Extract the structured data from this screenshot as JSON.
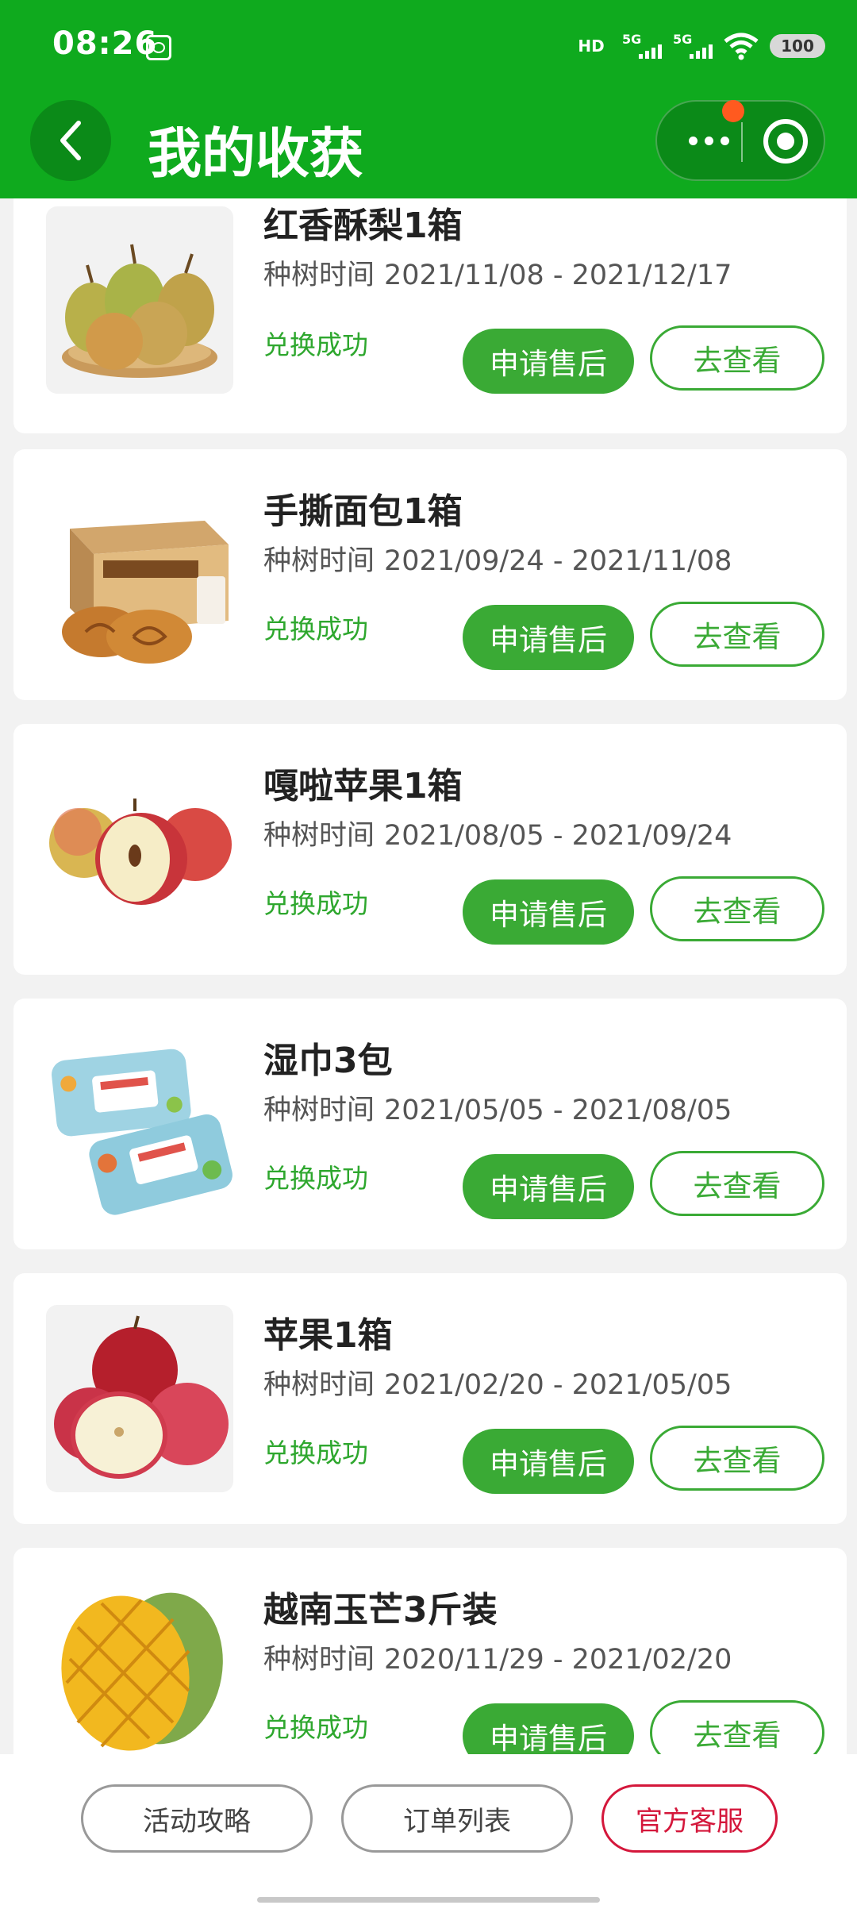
{
  "status_bar": {
    "time": "08:26",
    "hd_label": "HD",
    "net1": "5G",
    "net2": "5G",
    "battery": "100"
  },
  "header": {
    "title": "我的收获"
  },
  "items": [
    {
      "name": "红香酥梨1箱",
      "period_label": "种树时间",
      "period": "2021/11/08 - 2021/12/17",
      "status": "兑换成功",
      "after_sale": "申请售后",
      "view": "去查看",
      "image": "pears-icon"
    },
    {
      "name": "手撕面包1箱",
      "period_label": "种树时间",
      "period": "2021/09/24 - 2021/11/08",
      "status": "兑换成功",
      "after_sale": "申请售后",
      "view": "去查看",
      "image": "bread-box-icon"
    },
    {
      "name": "嘎啦苹果1箱",
      "period_label": "种树时间",
      "period": "2021/08/05 - 2021/09/24",
      "status": "兑换成功",
      "after_sale": "申请售后",
      "view": "去查看",
      "image": "gala-apple-icon"
    },
    {
      "name": "湿巾3包",
      "period_label": "种树时间",
      "period": "2021/05/05 - 2021/08/05",
      "status": "兑换成功",
      "after_sale": "申请售后",
      "view": "去查看",
      "image": "wet-wipes-icon"
    },
    {
      "name": "苹果1箱",
      "period_label": "种树时间",
      "period": "2021/02/20 - 2021/05/05",
      "status": "兑换成功",
      "after_sale": "申请售后",
      "view": "去查看",
      "image": "red-apples-icon"
    },
    {
      "name": "越南玉芒3斤装",
      "period_label": "种树时间",
      "period": "2020/11/29 - 2021/02/20",
      "status": "兑换成功",
      "after_sale": "申请售后",
      "view": "去查看",
      "image": "mango-icon"
    }
  ],
  "bottom_bar": {
    "activity": "活动攻略",
    "orders": "订单列表",
    "service": "官方客服"
  },
  "colors": {
    "brand_green": "#0faa1e",
    "button_green": "#3aaa35",
    "service_red": "#d4173b"
  }
}
